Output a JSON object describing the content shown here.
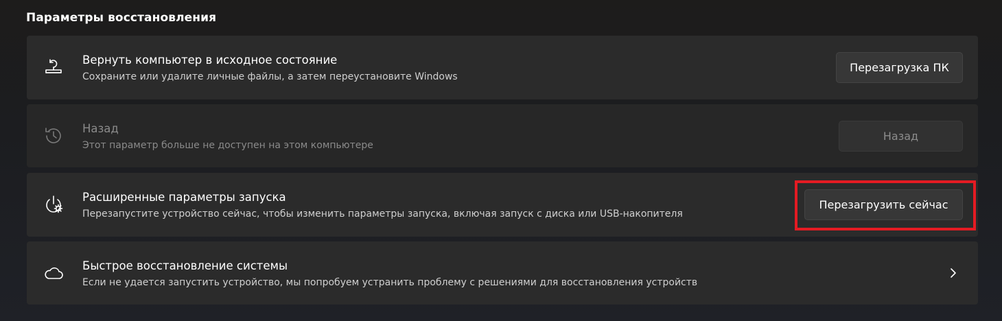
{
  "section": {
    "title": "Параметры восстановления"
  },
  "cards": [
    {
      "icon": "pc-reset-icon",
      "title": "Вернуть компьютер в исходное состояние",
      "subtitle": "Сохраните или удалите личные файлы, а затем переустановите Windows",
      "button": "Перезагрузка ПК",
      "enabled": true
    },
    {
      "icon": "history-icon",
      "title": "Назад",
      "subtitle": "Этот параметр больше не доступен на этом компьютере",
      "button": "Назад",
      "enabled": false
    },
    {
      "icon": "advanced-startup-icon",
      "title": "Расширенные параметры запуска",
      "subtitle": "Перезапустите устройство сейчас, чтобы изменить параметры запуска, включая запуск с диска или USB-накопителя",
      "button": "Перезагрузить сейчас",
      "enabled": true
    },
    {
      "icon": "cloud-icon",
      "title": "Быстрое восстановление системы",
      "subtitle": "Если не удается запустить устройство, мы попробуем устранить проблему с решениями для восстановления устройств",
      "enabled": true
    }
  ],
  "colors": {
    "highlight": "#e41b23",
    "card_background": "#2b2b2b",
    "page_background": "#1c1d20"
  }
}
